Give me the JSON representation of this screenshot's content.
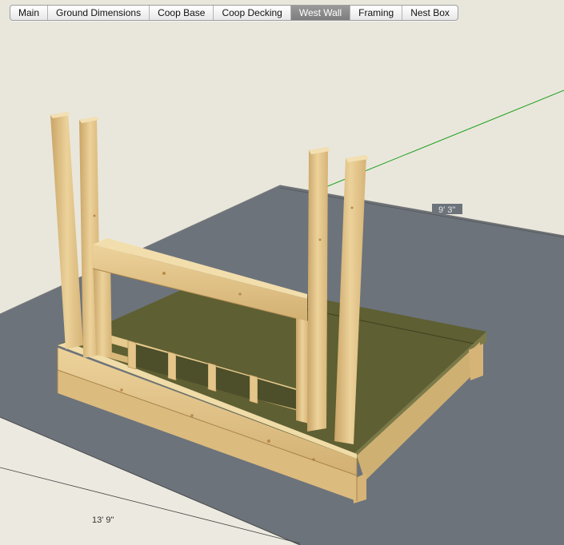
{
  "tabs": [
    {
      "label": "Main",
      "active": false
    },
    {
      "label": "Ground Dimensions",
      "active": false
    },
    {
      "label": "Coop Base",
      "active": false
    },
    {
      "label": "Coop Decking",
      "active": false
    },
    {
      "label": "West Wall",
      "active": true
    },
    {
      "label": "Framing",
      "active": false
    },
    {
      "label": "Nest Box",
      "active": false
    }
  ],
  "dimensions": {
    "width_label": "9' 3\"",
    "length_label": "13' 9\""
  },
  "colors": {
    "sky": "#e9e7dc",
    "ground": "#6c737b",
    "wood": "#e2c286",
    "plywood": "#5e5f32",
    "axis_green": "#1ea01e"
  }
}
